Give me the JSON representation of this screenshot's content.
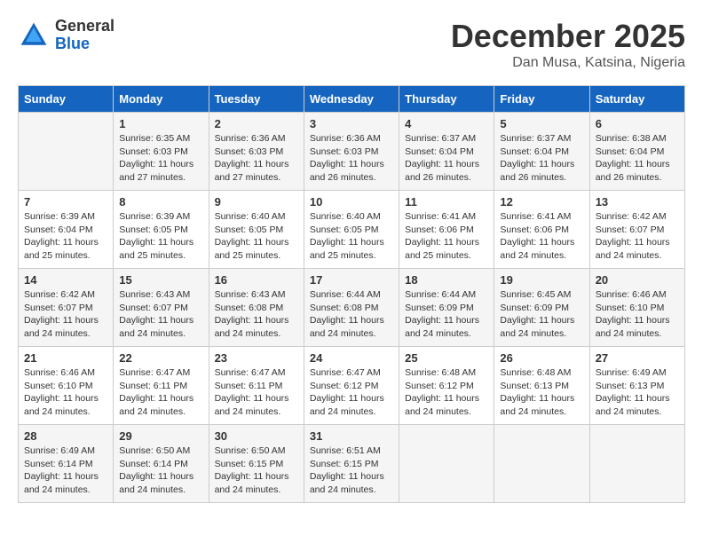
{
  "logo": {
    "general": "General",
    "blue": "Blue"
  },
  "header": {
    "month": "December 2025",
    "location": "Dan Musa, Katsina, Nigeria"
  },
  "weekdays": [
    "Sunday",
    "Monday",
    "Tuesday",
    "Wednesday",
    "Thursday",
    "Friday",
    "Saturday"
  ],
  "weeks": [
    [
      {
        "day": "",
        "sunrise": "",
        "sunset": "",
        "daylight": ""
      },
      {
        "day": "1",
        "sunrise": "Sunrise: 6:35 AM",
        "sunset": "Sunset: 6:03 PM",
        "daylight": "Daylight: 11 hours and 27 minutes."
      },
      {
        "day": "2",
        "sunrise": "Sunrise: 6:36 AM",
        "sunset": "Sunset: 6:03 PM",
        "daylight": "Daylight: 11 hours and 27 minutes."
      },
      {
        "day": "3",
        "sunrise": "Sunrise: 6:36 AM",
        "sunset": "Sunset: 6:03 PM",
        "daylight": "Daylight: 11 hours and 26 minutes."
      },
      {
        "day": "4",
        "sunrise": "Sunrise: 6:37 AM",
        "sunset": "Sunset: 6:04 PM",
        "daylight": "Daylight: 11 hours and 26 minutes."
      },
      {
        "day": "5",
        "sunrise": "Sunrise: 6:37 AM",
        "sunset": "Sunset: 6:04 PM",
        "daylight": "Daylight: 11 hours and 26 minutes."
      },
      {
        "day": "6",
        "sunrise": "Sunrise: 6:38 AM",
        "sunset": "Sunset: 6:04 PM",
        "daylight": "Daylight: 11 hours and 26 minutes."
      }
    ],
    [
      {
        "day": "7",
        "sunrise": "Sunrise: 6:39 AM",
        "sunset": "Sunset: 6:04 PM",
        "daylight": "Daylight: 11 hours and 25 minutes."
      },
      {
        "day": "8",
        "sunrise": "Sunrise: 6:39 AM",
        "sunset": "Sunset: 6:05 PM",
        "daylight": "Daylight: 11 hours and 25 minutes."
      },
      {
        "day": "9",
        "sunrise": "Sunrise: 6:40 AM",
        "sunset": "Sunset: 6:05 PM",
        "daylight": "Daylight: 11 hours and 25 minutes."
      },
      {
        "day": "10",
        "sunrise": "Sunrise: 6:40 AM",
        "sunset": "Sunset: 6:05 PM",
        "daylight": "Daylight: 11 hours and 25 minutes."
      },
      {
        "day": "11",
        "sunrise": "Sunrise: 6:41 AM",
        "sunset": "Sunset: 6:06 PM",
        "daylight": "Daylight: 11 hours and 25 minutes."
      },
      {
        "day": "12",
        "sunrise": "Sunrise: 6:41 AM",
        "sunset": "Sunset: 6:06 PM",
        "daylight": "Daylight: 11 hours and 24 minutes."
      },
      {
        "day": "13",
        "sunrise": "Sunrise: 6:42 AM",
        "sunset": "Sunset: 6:07 PM",
        "daylight": "Daylight: 11 hours and 24 minutes."
      }
    ],
    [
      {
        "day": "14",
        "sunrise": "Sunrise: 6:42 AM",
        "sunset": "Sunset: 6:07 PM",
        "daylight": "Daylight: 11 hours and 24 minutes."
      },
      {
        "day": "15",
        "sunrise": "Sunrise: 6:43 AM",
        "sunset": "Sunset: 6:07 PM",
        "daylight": "Daylight: 11 hours and 24 minutes."
      },
      {
        "day": "16",
        "sunrise": "Sunrise: 6:43 AM",
        "sunset": "Sunset: 6:08 PM",
        "daylight": "Daylight: 11 hours and 24 minutes."
      },
      {
        "day": "17",
        "sunrise": "Sunrise: 6:44 AM",
        "sunset": "Sunset: 6:08 PM",
        "daylight": "Daylight: 11 hours and 24 minutes."
      },
      {
        "day": "18",
        "sunrise": "Sunrise: 6:44 AM",
        "sunset": "Sunset: 6:09 PM",
        "daylight": "Daylight: 11 hours and 24 minutes."
      },
      {
        "day": "19",
        "sunrise": "Sunrise: 6:45 AM",
        "sunset": "Sunset: 6:09 PM",
        "daylight": "Daylight: 11 hours and 24 minutes."
      },
      {
        "day": "20",
        "sunrise": "Sunrise: 6:46 AM",
        "sunset": "Sunset: 6:10 PM",
        "daylight": "Daylight: 11 hours and 24 minutes."
      }
    ],
    [
      {
        "day": "21",
        "sunrise": "Sunrise: 6:46 AM",
        "sunset": "Sunset: 6:10 PM",
        "daylight": "Daylight: 11 hours and 24 minutes."
      },
      {
        "day": "22",
        "sunrise": "Sunrise: 6:47 AM",
        "sunset": "Sunset: 6:11 PM",
        "daylight": "Daylight: 11 hours and 24 minutes."
      },
      {
        "day": "23",
        "sunrise": "Sunrise: 6:47 AM",
        "sunset": "Sunset: 6:11 PM",
        "daylight": "Daylight: 11 hours and 24 minutes."
      },
      {
        "day": "24",
        "sunrise": "Sunrise: 6:47 AM",
        "sunset": "Sunset: 6:12 PM",
        "daylight": "Daylight: 11 hours and 24 minutes."
      },
      {
        "day": "25",
        "sunrise": "Sunrise: 6:48 AM",
        "sunset": "Sunset: 6:12 PM",
        "daylight": "Daylight: 11 hours and 24 minutes."
      },
      {
        "day": "26",
        "sunrise": "Sunrise: 6:48 AM",
        "sunset": "Sunset: 6:13 PM",
        "daylight": "Daylight: 11 hours and 24 minutes."
      },
      {
        "day": "27",
        "sunrise": "Sunrise: 6:49 AM",
        "sunset": "Sunset: 6:13 PM",
        "daylight": "Daylight: 11 hours and 24 minutes."
      }
    ],
    [
      {
        "day": "28",
        "sunrise": "Sunrise: 6:49 AM",
        "sunset": "Sunset: 6:14 PM",
        "daylight": "Daylight: 11 hours and 24 minutes."
      },
      {
        "day": "29",
        "sunrise": "Sunrise: 6:50 AM",
        "sunset": "Sunset: 6:14 PM",
        "daylight": "Daylight: 11 hours and 24 minutes."
      },
      {
        "day": "30",
        "sunrise": "Sunrise: 6:50 AM",
        "sunset": "Sunset: 6:15 PM",
        "daylight": "Daylight: 11 hours and 24 minutes."
      },
      {
        "day": "31",
        "sunrise": "Sunrise: 6:51 AM",
        "sunset": "Sunset: 6:15 PM",
        "daylight": "Daylight: 11 hours and 24 minutes."
      },
      {
        "day": "",
        "sunrise": "",
        "sunset": "",
        "daylight": ""
      },
      {
        "day": "",
        "sunrise": "",
        "sunset": "",
        "daylight": ""
      },
      {
        "day": "",
        "sunrise": "",
        "sunset": "",
        "daylight": ""
      }
    ]
  ]
}
